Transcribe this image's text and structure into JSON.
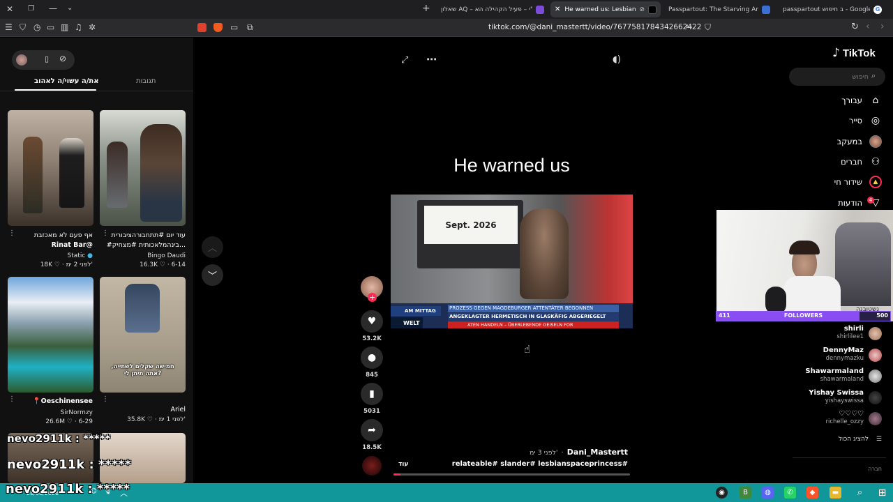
{
  "browser": {
    "tabs": [
      {
        "label": "שאלון AQ – אס\"י – פעיל הקהילה הא",
        "active": false
      },
      {
        "label": "He warned us: Lesbian Space",
        "active": true
      },
      {
        "label": "Passpartout: The Starving Artist on St",
        "active": false
      },
      {
        "label": "passpartout ב חיפוש - Google",
        "active": false
      }
    ],
    "url": "tiktok.com/@dani_mastertt/video/7677581784342662422"
  },
  "tiktok": {
    "logo": "TikTok",
    "search_placeholder": "חיפוש",
    "nav": [
      {
        "label": "עבורך",
        "icon": "home-icon"
      },
      {
        "label": "סייר",
        "icon": "compass-icon"
      },
      {
        "label": "במעקב",
        "icon": "following-avatar-icon"
      },
      {
        "label": "חברים",
        "icon": "friends-icon"
      },
      {
        "label": "שידור חי",
        "icon": "live-icon"
      },
      {
        "label": "הודעות",
        "icon": "inbox-icon",
        "badge": "4"
      }
    ],
    "following": [
      {
        "name": "shirli",
        "handle": "shirlilee1"
      },
      {
        "name": "DennyMaz",
        "handle": "dennymazku"
      },
      {
        "name": "Shawarmaland",
        "handle": "shawarmaland"
      },
      {
        "name": "Yishay Swissa",
        "handle": "yishayswissa"
      },
      {
        "name": "♡♡♡♡",
        "handle": "richelle_ozzy"
      }
    ],
    "see_all": "להציג הכול",
    "footer_fragment": "חברה"
  },
  "webcam": {
    "followers_label": "FOLLOWERS",
    "followers_current": "411",
    "followers_goal": "500",
    "overlay_text": "נשטובנה"
  },
  "left_panel": {
    "tabs": [
      {
        "label": "את/ה עשוי/ה לאהוב",
        "active": true
      },
      {
        "label": "תגובות",
        "active": false
      }
    ],
    "cards": [
      {
        "title_line1": "אף פעם לא מאכזבת",
        "title_line2": "Rinat Bar@",
        "author": "Static",
        "likes": "18K",
        "ago": "לפני 2 ימ'"
      },
      {
        "title_line1": "עוד יום #תתחבורהציבורית",
        "title_line2": "#בינהמלאכותית #מצחיק...",
        "author": "Bingo Daudi",
        "likes": "16.3K",
        "ago": "6-14"
      },
      {
        "title_line1": "📍Oeschinensee",
        "title_line2": "",
        "author": "SirNormzy",
        "likes": "26.6M",
        "ago": "6-29"
      },
      {
        "title_line1": "",
        "title_line2": "",
        "author": "Ariel",
        "likes": "35.8K",
        "ago": "לפני 1 ימ'",
        "caption": "חמישה שקלים לשתייה, אתה תיתן לי?"
      }
    ],
    "chat_overlay": [
      "nevo2911k : *****",
      "nevo2911k : *****",
      "nevo2911k : *****"
    ]
  },
  "video": {
    "title": "He warned us",
    "sign_text": "Sept. 2026",
    "ticker": {
      "channel": "WELT",
      "segment": "AM MITTAG",
      "line1": "PROZESS GEGEN MAGDEBURGER ATTENTÄTER BEGONNEN",
      "line2": "ANGEKLAGTER HERMETISCH IN GLASKÄFIG ABGERIEGELT",
      "line3": "ATEN HANDELN – ÜBERLEBENDE GEISELN FOR"
    },
    "author": "Dani_Mastertt",
    "ago": "לפני 3 ימ'",
    "hashtags": "relateable# slander# lesbianspaceprincess#",
    "more": "עוד",
    "progress": 0.03,
    "actions": {
      "likes": "53.2K",
      "comments": "845",
      "saves": "5031",
      "shares": "18.5K"
    }
  },
  "taskbar": {
    "date": "28/08/2026"
  }
}
